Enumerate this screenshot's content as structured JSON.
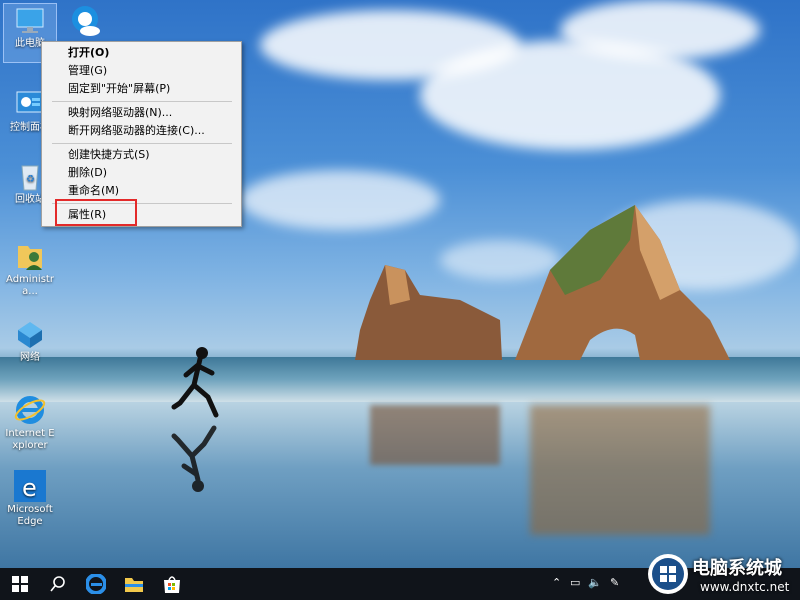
{
  "desktop_icons": [
    {
      "label": "此电脑"
    },
    {
      "label": "控制面板"
    },
    {
      "label": "回收站"
    },
    {
      "label": "Administra..."
    },
    {
      "label": "网络"
    },
    {
      "label": "Internet Explorer"
    },
    {
      "label": "Microsoft Edge"
    }
  ],
  "context_menu": {
    "items": [
      {
        "label": "打开(O)"
      },
      {
        "label": "管理(G)"
      },
      {
        "label": "固定到\"开始\"屏幕(P)"
      },
      {
        "label": "映射网络驱动器(N)..."
      },
      {
        "label": "断开网络驱动器的连接(C)..."
      },
      {
        "label": "创建快捷方式(S)"
      },
      {
        "label": "删除(D)"
      },
      {
        "label": "重命名(M)"
      },
      {
        "label": "属性(R)"
      }
    ]
  },
  "watermark": {
    "text": "电脑系统城",
    "url": "www.dnxtc.net"
  },
  "colors": {
    "highlight_box": "#e32a2a",
    "taskbar": "#10141a"
  }
}
